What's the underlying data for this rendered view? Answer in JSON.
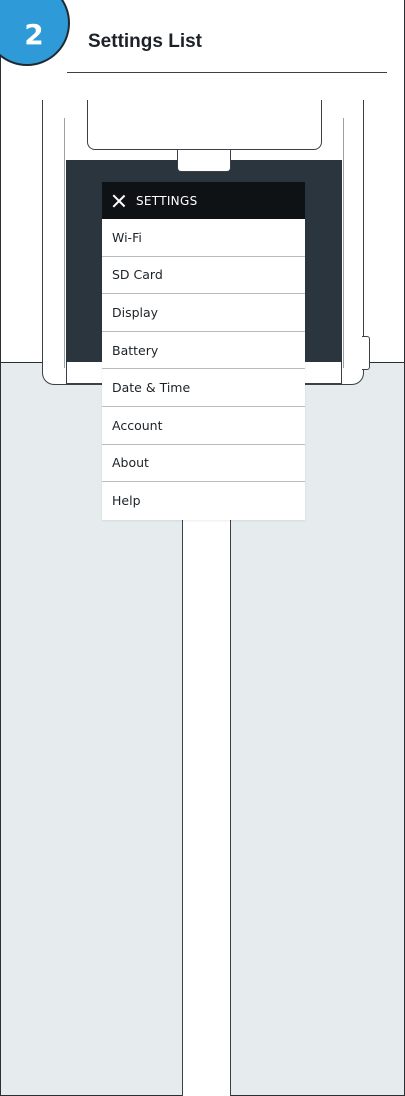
{
  "header": {
    "step_number": "2",
    "title": "Settings List"
  },
  "settings_menu": {
    "title": "SETTINGS",
    "items": [
      {
        "label": "Wi-Fi"
      },
      {
        "label": "SD Card"
      },
      {
        "label": "Display"
      },
      {
        "label": "Battery"
      },
      {
        "label": "Date & Time"
      },
      {
        "label": "Account"
      },
      {
        "label": "About"
      },
      {
        "label": "Help"
      }
    ]
  },
  "colors": {
    "badge": "#2e9ad8",
    "screen": "#2b353d",
    "menu_header": "#0f1214",
    "lower_panel": "#e6ebee"
  }
}
